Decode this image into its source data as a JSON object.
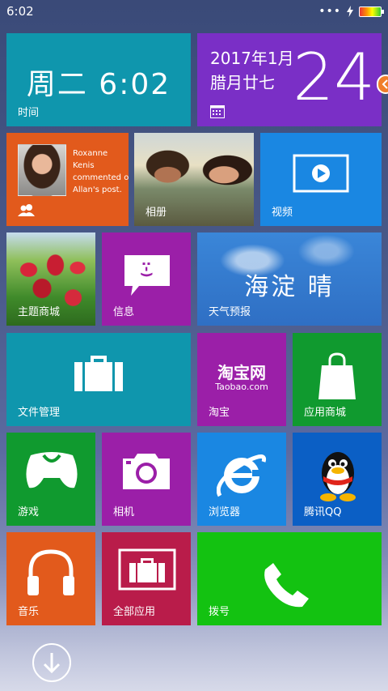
{
  "status": {
    "time": "6:02",
    "dots": "•••"
  },
  "tiles": {
    "clock": {
      "text": "周二 6:02",
      "label": "时间"
    },
    "calendar": {
      "date": "2017年1月",
      "lunar": "腊月廿七",
      "day": "24"
    },
    "social": {
      "text": "Roxanne Kenis commented o Allan's post."
    },
    "album": {
      "label": "相册"
    },
    "video": {
      "label": "视频"
    },
    "theme": {
      "label": "主题商城"
    },
    "message": {
      "label": "信息",
      "icon_text": ":-)"
    },
    "weather": {
      "text": "海淀 晴",
      "label": "天气预报"
    },
    "files": {
      "label": "文件管理"
    },
    "taobao": {
      "logo": "淘宝网",
      "sub": "Taobao.com",
      "label": "淘宝"
    },
    "store": {
      "label": "应用商城"
    },
    "game": {
      "label": "游戏"
    },
    "camera": {
      "label": "相机"
    },
    "browser": {
      "label": "浏览器"
    },
    "qq": {
      "label": "腾讯QQ"
    },
    "music": {
      "label": "音乐"
    },
    "allapps": {
      "label": "全部应用"
    },
    "dial": {
      "label": "拨号"
    }
  },
  "icons": {
    "calendar": "calendar-icon",
    "people": "people-icon",
    "video": "play-icon",
    "message": "chat-bubble-icon",
    "files": "briefcase-icon",
    "store": "shopping-bag-icon",
    "game": "xbox-controller-icon",
    "camera": "camera-icon",
    "browser": "ie-browser-icon",
    "qq": "penguin-icon",
    "music": "headphones-icon",
    "allapps": "apps-briefcase-icon",
    "dial": "phone-icon",
    "down": "down-arrow-icon"
  },
  "colors": {
    "teal": "#0f96ad",
    "purple": "#7a2fc6",
    "orange": "#e25a1c",
    "blue": "#1a87e2",
    "magenta": "#9b1fa8",
    "green": "#109a2f",
    "crimson": "#b91c4a",
    "lime": "#13c211"
  }
}
